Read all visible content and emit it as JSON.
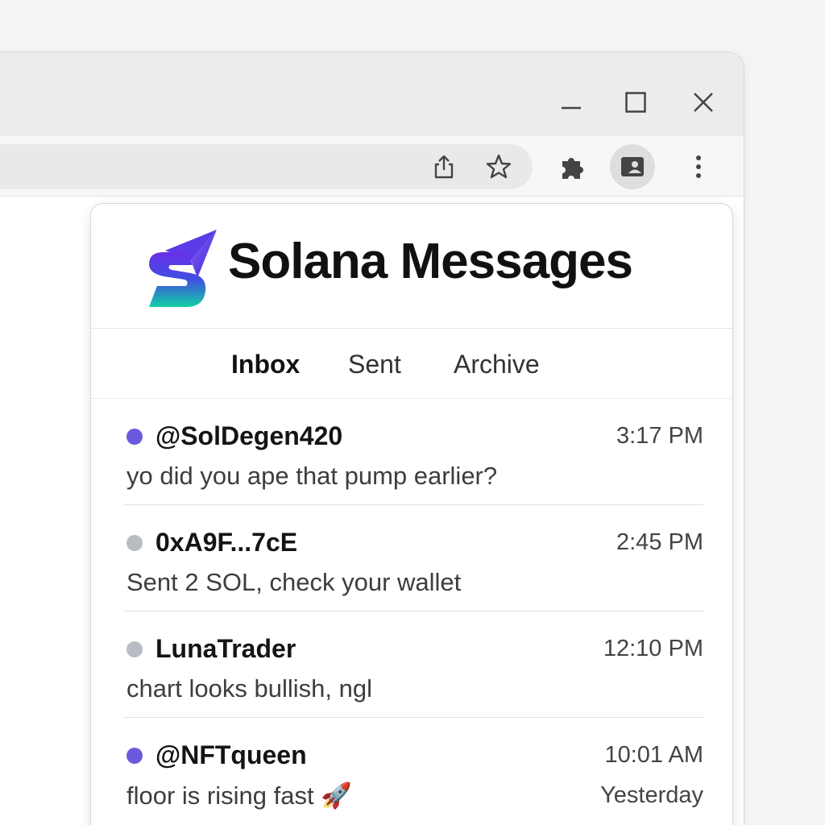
{
  "browser": {
    "window_controls": {
      "minimize_icon": "minimize-icon",
      "maximize_icon": "maximize-icon",
      "close_icon": "close-icon"
    },
    "toolbar": {
      "share_icon": "share-icon",
      "bookmark_icon": "star-icon",
      "extensions_icon": "puzzle-icon",
      "profile_icon": "profile-card-icon",
      "menu_icon": "more-vert-icon"
    }
  },
  "extension": {
    "title": "Solana Messages",
    "logo_icon": "solana-messages-logo",
    "tabs": [
      {
        "label": "Inbox",
        "active": true
      },
      {
        "label": "Sent",
        "active": false
      },
      {
        "label": "Archive",
        "active": false
      }
    ],
    "messages": [
      {
        "sender": "@SolDegen420",
        "time": "3:17 PM",
        "preview": "yo did you ape that pump earlier?",
        "unread": true,
        "subtime": ""
      },
      {
        "sender": "0xA9F...7cE",
        "time": "2:45 PM",
        "preview": "Sent 2 SOL, check your wallet",
        "unread": false,
        "subtime": ""
      },
      {
        "sender": "LunaTrader",
        "time": "12:10 PM",
        "preview": "chart looks bullish, ngl",
        "unread": false,
        "subtime": ""
      },
      {
        "sender": "@NFTqueen",
        "time": "10:01 AM",
        "preview": "floor is rising fast 🚀",
        "unread": true,
        "subtime": "Yesterday"
      }
    ]
  },
  "colors": {
    "unread_dot": "#6a5ae0",
    "read_dot": "#b9bcc2",
    "logo_gradient_top": "#5b2ee0",
    "logo_gradient_bottom": "#14c8a8"
  }
}
